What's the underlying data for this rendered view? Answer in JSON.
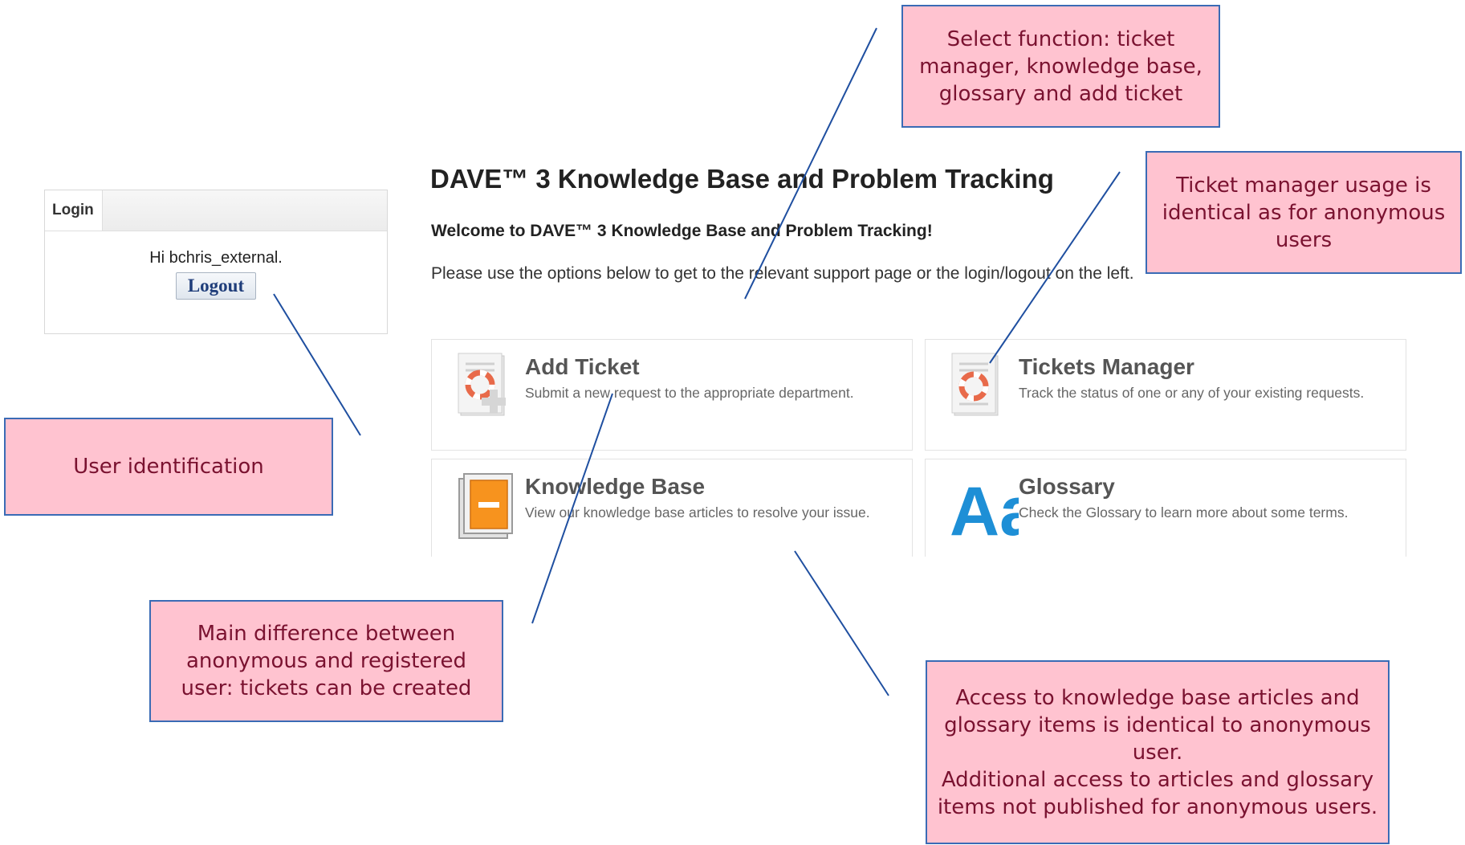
{
  "login": {
    "tab_label": "Login",
    "greeting": "Hi bchris_external.",
    "logout_label": "Logout"
  },
  "main": {
    "title": "DAVE™ 3 Knowledge Base and Problem Tracking",
    "welcome": "Welcome to DAVE™ 3 Knowledge Base and Problem Tracking!",
    "instructions": "Please use the options below to get to the relevant support page or the login/logout on the left."
  },
  "cards": [
    {
      "title": "Add Ticket",
      "description": "Submit a new request to the appropriate department.",
      "icon": "add-ticket-icon"
    },
    {
      "title": "Tickets Manager",
      "description": "Track the status of one or any of your existing requests.",
      "icon": "tickets-manager-icon"
    },
    {
      "title": "Knowledge Base",
      "description": "View our knowledge base articles to resolve your issue.",
      "icon": "knowledge-base-icon"
    },
    {
      "title": "Glossary",
      "description": "Check the Glossary to learn more about some terms.",
      "icon": "glossary-icon"
    }
  ],
  "callouts": {
    "select_function": "Select function: ticket manager, knowledge base, glossary and add ticket",
    "ticket_manager": "Ticket manager usage is identical as for anonymous users",
    "user_identification": "User identification",
    "main_difference": "Main difference between anonymous and registered user: tickets can be created",
    "access": "Access to knowledge base articles and glossary items is identical to anonymous user.\nAdditional access to articles and glossary items not published for anonymous users."
  },
  "colors": {
    "callout_fill": "#ffc3d0",
    "callout_border": "#3a6bb5",
    "callout_text": "#7a1230",
    "leader_line": "#1f4fa0",
    "knowledge_base_accent": "#f7931e",
    "glossary_accent": "#1e8fd6"
  }
}
